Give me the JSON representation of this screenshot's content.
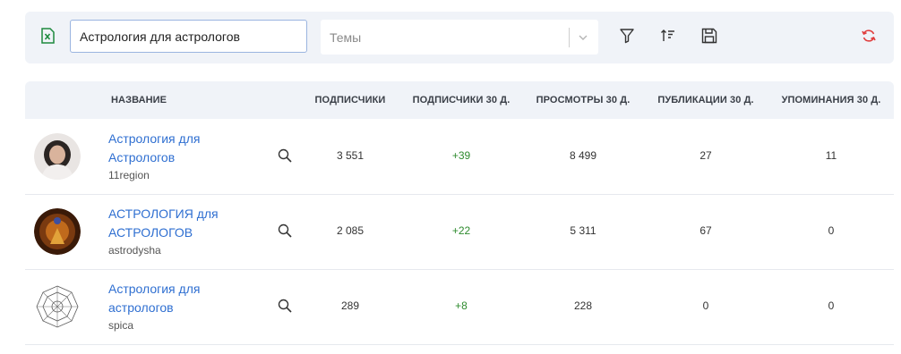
{
  "toolbar": {
    "search_value": "Астрология для астрологов",
    "topics_placeholder": "Темы"
  },
  "icons": {
    "excel": "excel-export-icon",
    "filter": "filter-icon",
    "sort": "sort-icon",
    "save": "save-icon",
    "refresh": "refresh-icon",
    "row_search": "search-icon"
  },
  "colors": {
    "accent_link": "#2f6fd1",
    "positive": "#2e8b2e",
    "excel_green": "#1e8a3e",
    "refresh_red": "#e03c3c"
  },
  "table": {
    "columns": [
      "НАЗВАНИЕ",
      "ПОДПИСЧИКИ",
      "ПОДПИСЧИКИ 30 Д.",
      "ПРОСМОТРЫ 30 Д.",
      "ПУБЛИКАЦИИ 30 Д.",
      "УПОМИНАНИЯ 30 Д."
    ],
    "rows": [
      {
        "name": "Астрология для Астрологов",
        "handle": "11region",
        "subscribers": "3 551",
        "subscribers_30d": "+39",
        "views_30d": "8 499",
        "posts_30d": "27",
        "mentions_30d": "11"
      },
      {
        "name": "АСТРОЛОГИЯ для АСТРОЛОГОВ",
        "handle": "astrodysha",
        "subscribers": "2 085",
        "subscribers_30d": "+22",
        "views_30d": "5 311",
        "posts_30d": "67",
        "mentions_30d": "0"
      },
      {
        "name": "Астрология для астрологов",
        "handle": "spica",
        "subscribers": "289",
        "subscribers_30d": "+8",
        "views_30d": "228",
        "posts_30d": "0",
        "mentions_30d": "0"
      }
    ]
  }
}
